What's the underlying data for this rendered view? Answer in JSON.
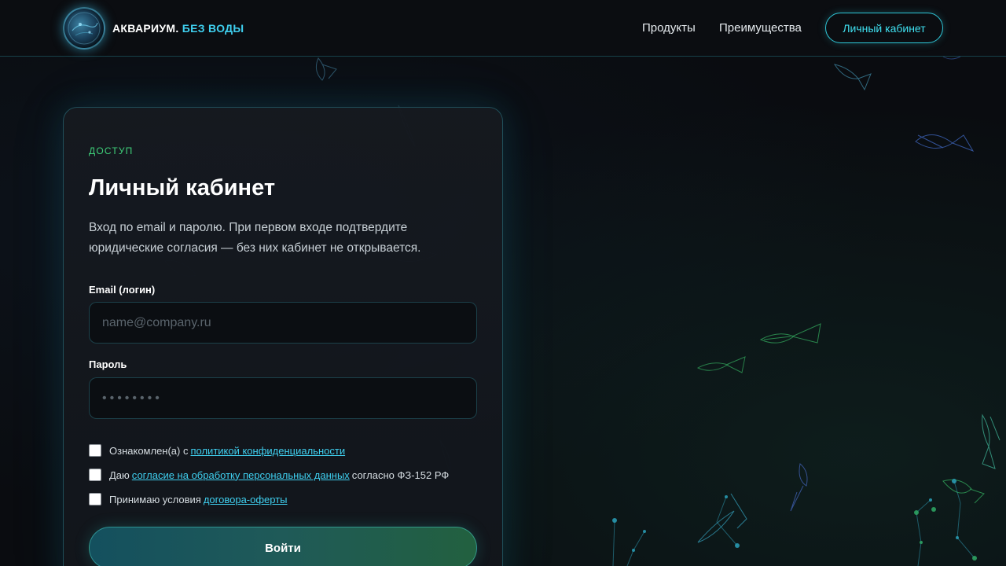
{
  "header": {
    "brand_main": "АКВАРИУМ.",
    "brand_accent": "БЕЗ ВОДЫ",
    "nav": {
      "products": "Продукты",
      "benefits": "Преимущества",
      "cabinet": "Личный кабинет"
    }
  },
  "card": {
    "eyebrow": "ДОСТУП",
    "title": "Личный кабинет",
    "lead": "Вход по email и паролю. При первом входе подтвердите юридические согласия — без них кабинет не открывается.",
    "email": {
      "label": "Email (логин)",
      "placeholder": "name@company.ru",
      "value": ""
    },
    "password": {
      "label": "Пароль",
      "placeholder": "••••••••",
      "value": ""
    },
    "consents": [
      {
        "before": "Ознакомлен(а) с",
        "link": "политикой конфиденциальности",
        "after": "",
        "checked": false
      },
      {
        "before": "Даю",
        "link": "согласие на обработку персональных данных",
        "after": "согласно ФЗ-152 РФ",
        "checked": false
      },
      {
        "before": "Принимаю условия",
        "link": "договора-оферты",
        "after": "",
        "checked": false
      }
    ],
    "submit_label": "Войти"
  },
  "colors": {
    "background": "#0a0c10",
    "accent_cyan": "#3fd0f0",
    "accent_green": "#3fd07a",
    "card_border": "#2fa8b8"
  },
  "icons": {
    "logo": "aquarium-globe-logo",
    "decor": "fish-outline-icon"
  }
}
